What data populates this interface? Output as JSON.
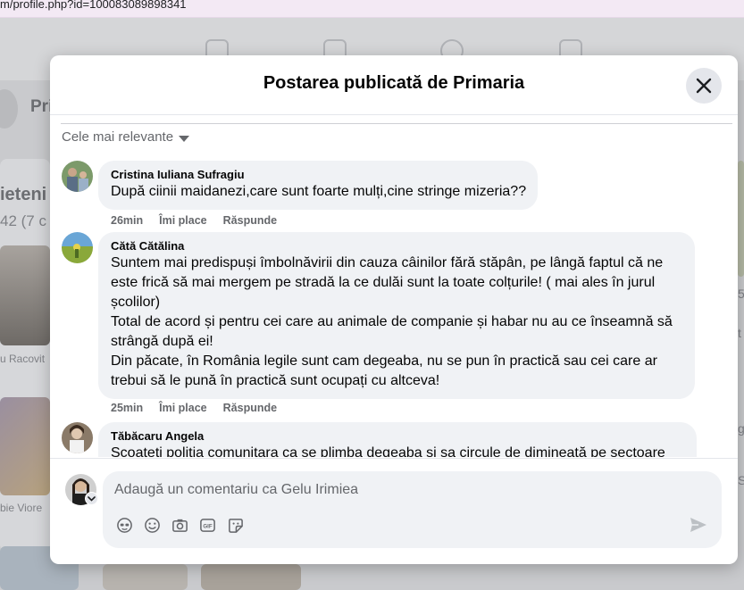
{
  "browser": {
    "url": "m/profile.php?id=100083089898341"
  },
  "background": {
    "profile_name_partial": "Pri",
    "friends_title_partial": "ieteni",
    "friends_count_partial": "42 (7 c",
    "friend_1_partial": "u Racovit",
    "friend_2_partial": "bie Viore",
    "right_partial_1": "5",
    "right_partial_2": "t",
    "right_partial_3": "g",
    "right_partial_4": "S"
  },
  "modal": {
    "title": "Postarea publicată de Primaria",
    "sort_label": "Cele mai relevante",
    "comments": [
      {
        "author": "Cristina Iuliana Sufragiu",
        "text": "După ciinii maidanezi,care sunt foarte mulți,cine stringe mizeria??",
        "time": "26min",
        "like": "Îmi place",
        "reply": "Răspunde"
      },
      {
        "author": "Cătă Cătălina",
        "text": "Suntem mai predispuși îmbolnăvirii din cauza câinilor fără stăpân, pe lângă faptul că ne\neste frică să mai mergem pe stradă la ce dulăi sunt la toate colțurile! ( mai ales în jurul\nșcolilor)\nTotal de acord și pentru cei care au animale de companie și habar nu au ce înseamnă să\nstrângă după ei!\nDin păcate, în România legile sunt cam degeaba, nu se pun în practică sau cei care ar\ntrebui să le pună în practică sunt ocupați cu altceva!",
        "time": "25min",
        "like": "Îmi place",
        "reply": "Răspunde"
      },
      {
        "author": "Tăbăcaru Angela",
        "text": "Scoateti politia comunitara ca se plimba degeaba si sa circule de dimineată pe sectoare"
      }
    ],
    "composer": {
      "placeholder": "Adaugă un comentariu ca Gelu Irimiea",
      "tools": [
        "avatar-sticker-icon",
        "emoji-icon",
        "camera-icon",
        "gif-icon",
        "sticker-icon"
      ],
      "send_icon": "send-icon"
    }
  },
  "colors": {
    "bubble": "#f0f2f5",
    "meta_text": "#65676b",
    "close_bg": "#e4e6eb"
  }
}
